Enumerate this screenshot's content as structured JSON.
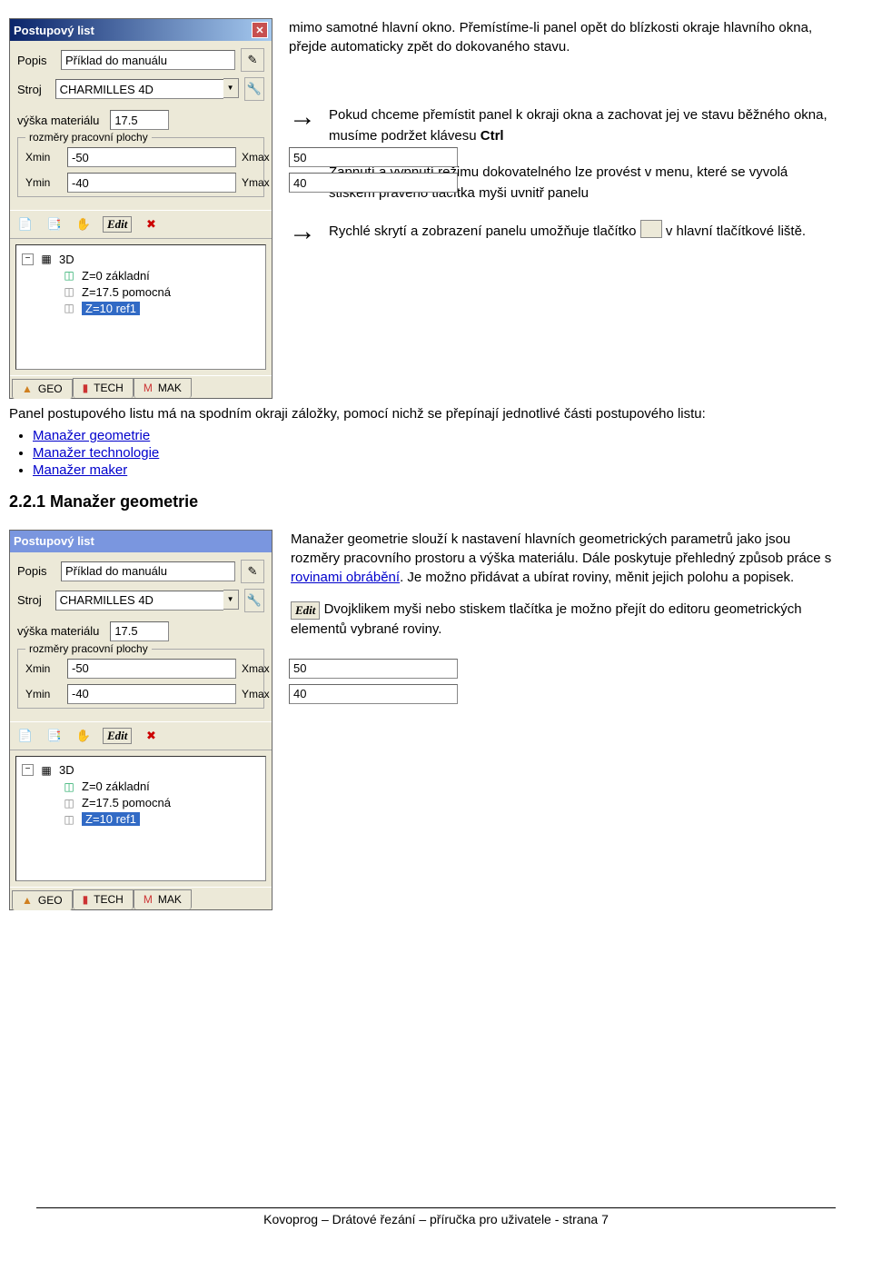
{
  "panel": {
    "title": "Postupový list",
    "close": "✕",
    "popis_lbl": "Popis",
    "popis_val": "Příklad do manuálu",
    "stroj_lbl": "Stroj",
    "stroj_val": "CHARMILLES 4D",
    "combo_arrow": "▼",
    "vyska_lbl": "výška materiálu",
    "vyska_val": "17.5",
    "rozmery_legend": "rozměry pracovní plochy",
    "xmin_lbl": "Xmin",
    "xmin_val": "-50",
    "xmax_lbl": "Xmax",
    "xmax_val": "50",
    "ymin_lbl": "Ymin",
    "ymin_val": "-40",
    "ymax_lbl": "Ymax",
    "ymax_val": "40",
    "edit_word": "Edit",
    "tree": {
      "minus": "−",
      "root": "3D",
      "r1": "Z=0 základní",
      "r2": "Z=17.5 pomocná",
      "r3": "Z=10 ref1"
    },
    "tabs": {
      "geo": "GEO",
      "tech": "TECH",
      "mak": "MAK"
    }
  },
  "text": {
    "intro": "mimo samotné hlavní okno. Přemístíme-li panel opět do blízkosti okraje hlavního okna, přejde automaticky zpět do dokovaného stavu.",
    "bullet1a": "Pokud chceme přemístit panel k okraji okna a zachovat jej ve stavu běžného okna, musíme podržet klávesu ",
    "bullet1b": "Ctrl",
    "bullet2": "Zapnutí a vypnutí režimu dokovatelného lze provést v menu, které se vyvolá stiskem pravého tlačítka myši uvnitř panelu",
    "bullet3a": "Rychlé skrytí a zobrazení panelu umožňuje tlačítko ",
    "bullet3b": " v hlavní tlačítkové liště.",
    "after": "Panel postupového listu má na spodním okraji záložky, pomocí nichž se přepínají jednotlivé části postupového listu:",
    "links": {
      "l1": "Manažer geometrie",
      "l2": "Manažer technologie",
      "l3": "Manažer maker"
    },
    "heading": "2.2.1 Manažer geometrie",
    "sec1a": "Manažer geometrie slouží k nastavení hlavních geometrických parametrů jako jsou rozměry pracovního prostoru a výška materiálu. Dále poskytuje přehledný způsob práce s ",
    "sec1link": "rovinami obrábění",
    "sec1b": ". Je možno přidávat a ubírat roviny, měnit jejich polohu a popisek.",
    "sec2": " Dvojklikem myši nebo stiskem tlačítka je možno přejít do editoru geometrických elementů vybrané roviny.",
    "arrow": "→"
  },
  "footer": "Kovoprog – Drátové řezání – příručka pro uživatele - strana 7"
}
